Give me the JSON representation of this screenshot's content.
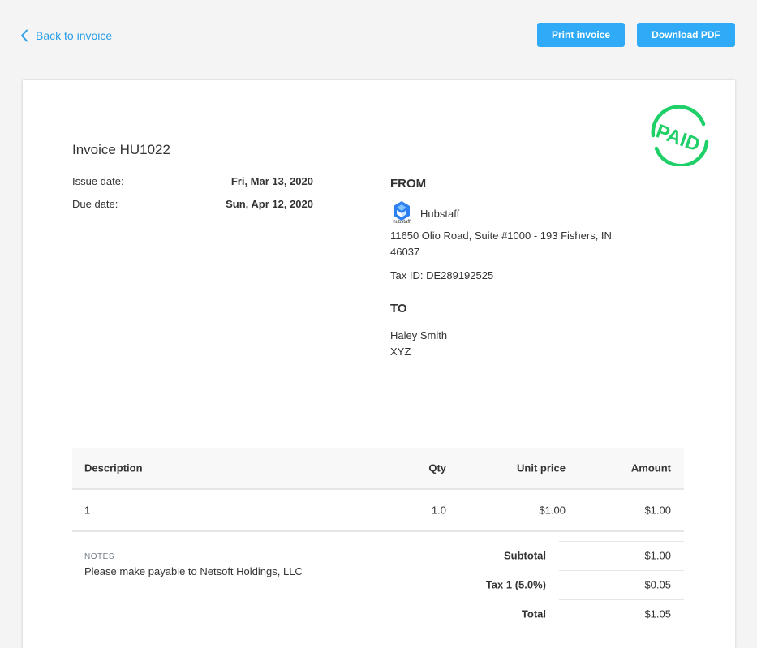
{
  "topbar": {
    "back_label": "Back to invoice",
    "print_label": "Print invoice",
    "pdf_label": "Download PDF"
  },
  "stamp": {
    "text": "PAID",
    "color": "#1fcf68"
  },
  "invoice": {
    "title": "Invoice HU1022",
    "issue_label": "Issue date:",
    "issue_value": "Fri, Mar 13, 2020",
    "due_label": "Due date:",
    "due_value": "Sun, Apr 12, 2020"
  },
  "from": {
    "heading": "FROM",
    "company": "Hubstaff",
    "logo_word": "hubstaff",
    "address": "11650 Olio Road, Suite #1000 - 193 Fishers, IN 46037",
    "tax_id": "Tax ID: DE289192525"
  },
  "to": {
    "heading": "TO",
    "name": "Haley Smith",
    "company": "XYZ"
  },
  "table": {
    "headers": {
      "description": "Description",
      "qty": "Qty",
      "unit_price": "Unit price",
      "amount": "Amount"
    },
    "rows": [
      {
        "description": "1",
        "qty": "1.0",
        "unit_price": "$1.00",
        "amount": "$1.00"
      }
    ]
  },
  "notes": {
    "label": "NOTES",
    "text": "Please make payable to Netsoft Holdings, LLC"
  },
  "totals": {
    "subtotal_label": "Subtotal",
    "subtotal_value": "$1.00",
    "tax_label": "Tax 1 (5.0%)",
    "tax_value": "$0.05",
    "total_label": "Total",
    "total_value": "$1.05"
  },
  "colors": {
    "accent": "#2eaaf6",
    "link": "#2b9fe8",
    "paid": "#1fcf68"
  }
}
